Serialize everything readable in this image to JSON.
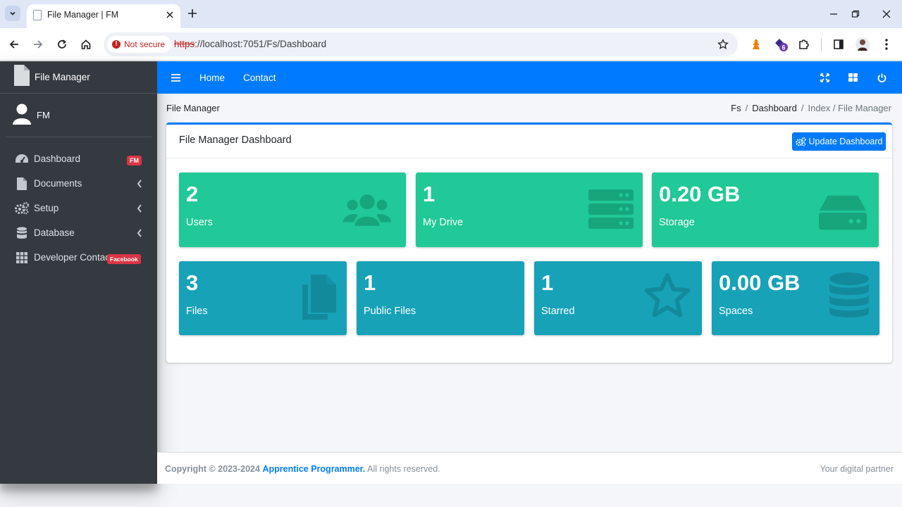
{
  "browser": {
    "tab_title": "File Manager | FM",
    "security_label": "Not secure",
    "url_scheme": "https",
    "url_rest": "://localhost:7051/Fs/Dashboard",
    "extension_badge": "6"
  },
  "sidebar": {
    "brand": "File Manager",
    "user": "FM",
    "items": [
      {
        "label": "Dashboard",
        "icon": "dashboard-icon",
        "badge": "FM"
      },
      {
        "label": "Documents",
        "icon": "document-icon"
      },
      {
        "label": "Setup",
        "icon": "cogs-icon"
      },
      {
        "label": "Database",
        "icon": "database-icon"
      },
      {
        "label": "Developer Contact",
        "icon": "grid-icon",
        "badge": "Facebook"
      }
    ]
  },
  "navbar": {
    "links": [
      "Home",
      "Contact"
    ]
  },
  "header": {
    "title": "File Manager",
    "breadcrumb": [
      "Fs",
      "Dashboard",
      "Index / File Manager"
    ]
  },
  "card": {
    "title": "File Manager Dashboard",
    "button": "Update Dashboard"
  },
  "stats": [
    {
      "value": "2",
      "label": "Users",
      "icon": "users-icon",
      "color": "#20c997"
    },
    {
      "value": "1",
      "label": "My Drive",
      "icon": "server-icon",
      "color": "#20c997"
    },
    {
      "value": "0.20 GB",
      "label": "Storage",
      "icon": "hdd-icon",
      "color": "#20c997"
    },
    {
      "value": "3",
      "label": "Files",
      "icon": "copy-icon",
      "color": "#17a2b8"
    },
    {
      "value": "1",
      "label": "Public Files",
      "icon": "",
      "color": "#17a2b8"
    },
    {
      "value": "1",
      "label": "Starred",
      "icon": "star-icon",
      "color": "#17a2b8"
    },
    {
      "value": "0.00 GB",
      "label": "Spaces",
      "icon": "database-icon",
      "color": "#17a2b8"
    }
  ],
  "footer": {
    "copyright": "Copyright © 2023-2024",
    "company": "Apprentice Programmer.",
    "rights": "All rights reserved.",
    "tagline": "Your digital partner"
  }
}
